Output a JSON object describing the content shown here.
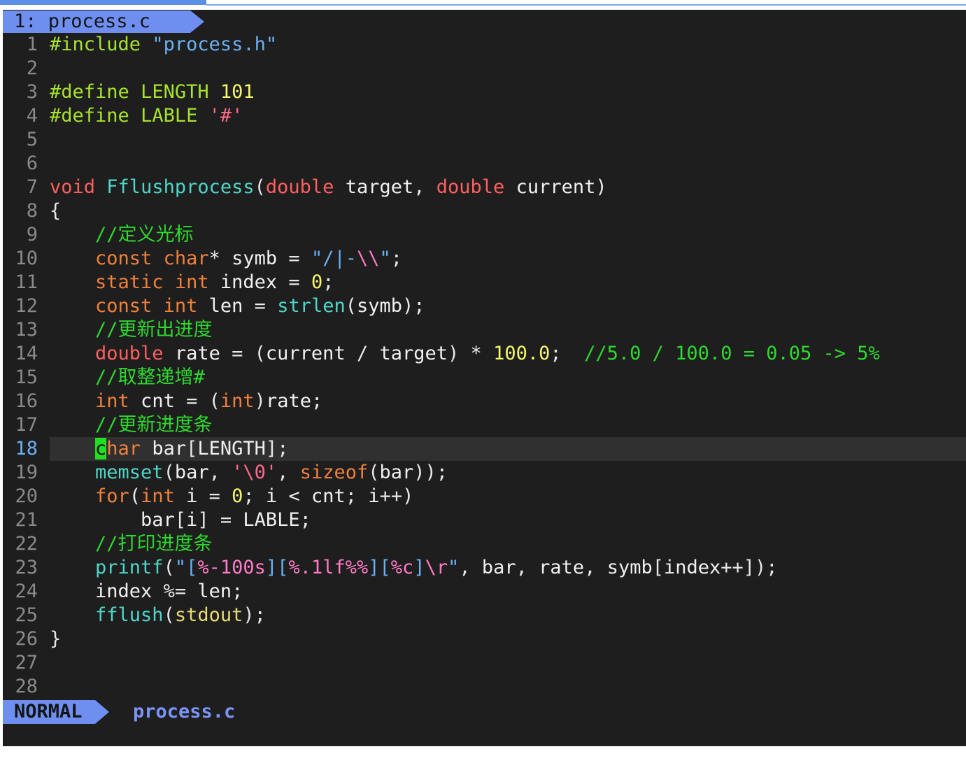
{
  "window": {
    "tab_label": "1: process.c"
  },
  "editor": {
    "cursor_line": 18,
    "lines": [
      {
        "n": "1",
        "text": "#include \"process.h\""
      },
      {
        "n": "2",
        "text": ""
      },
      {
        "n": "3",
        "text": "#define LENGTH 101"
      },
      {
        "n": "4",
        "text": "#define LABLE '#'"
      },
      {
        "n": "5",
        "text": ""
      },
      {
        "n": "6",
        "text": ""
      },
      {
        "n": "7",
        "text": "void Fflushprocess(double target, double current)"
      },
      {
        "n": "8",
        "text": "{"
      },
      {
        "n": "9",
        "text": "    //定义光标"
      },
      {
        "n": "10",
        "text": "    const char* symb = \"/|-\\\\\";"
      },
      {
        "n": "11",
        "text": "    static int index = 0;"
      },
      {
        "n": "12",
        "text": "    const int len = strlen(symb);"
      },
      {
        "n": "13",
        "text": "    //更新出进度"
      },
      {
        "n": "14",
        "text": "    double rate = (current / target) * 100.0;  //5.0 / 100.0 = 0.05 -> 5%"
      },
      {
        "n": "15",
        "text": "    //取整递增#"
      },
      {
        "n": "16",
        "text": "    int cnt = (int)rate;"
      },
      {
        "n": "17",
        "text": "    //更新进度条"
      },
      {
        "n": "18",
        "text": "    char bar[LENGTH];"
      },
      {
        "n": "19",
        "text": "    memset(bar, '\\0', sizeof(bar));"
      },
      {
        "n": "20",
        "text": "    for(int i = 0; i < cnt; i++)"
      },
      {
        "n": "21",
        "text": "        bar[i] = LABLE;"
      },
      {
        "n": "22",
        "text": "    //打印进度条"
      },
      {
        "n": "23",
        "text": "    printf(\"[%-100s][%.1lf%%][%c]\\r\", bar, rate, symb[index++]);"
      },
      {
        "n": "24",
        "text": "    index %= len;"
      },
      {
        "n": "25",
        "text": "    fflush(stdout);"
      },
      {
        "n": "26",
        "text": "}"
      },
      {
        "n": "27",
        "text": ""
      },
      {
        "n": "28",
        "text": ""
      }
    ]
  },
  "statusline": {
    "mode": "NORMAL",
    "file": "process.c"
  },
  "colors": {
    "background": "#1e1e1e",
    "mode_accent": "#6f8ff0",
    "cursor": "#22dd22",
    "keyword": "#f0803c",
    "preprocessor": "#a6e22e",
    "string": "#6ab0f5",
    "number": "#f5f56a",
    "function": "#4fd6c8",
    "comment": "#2ed82e"
  }
}
